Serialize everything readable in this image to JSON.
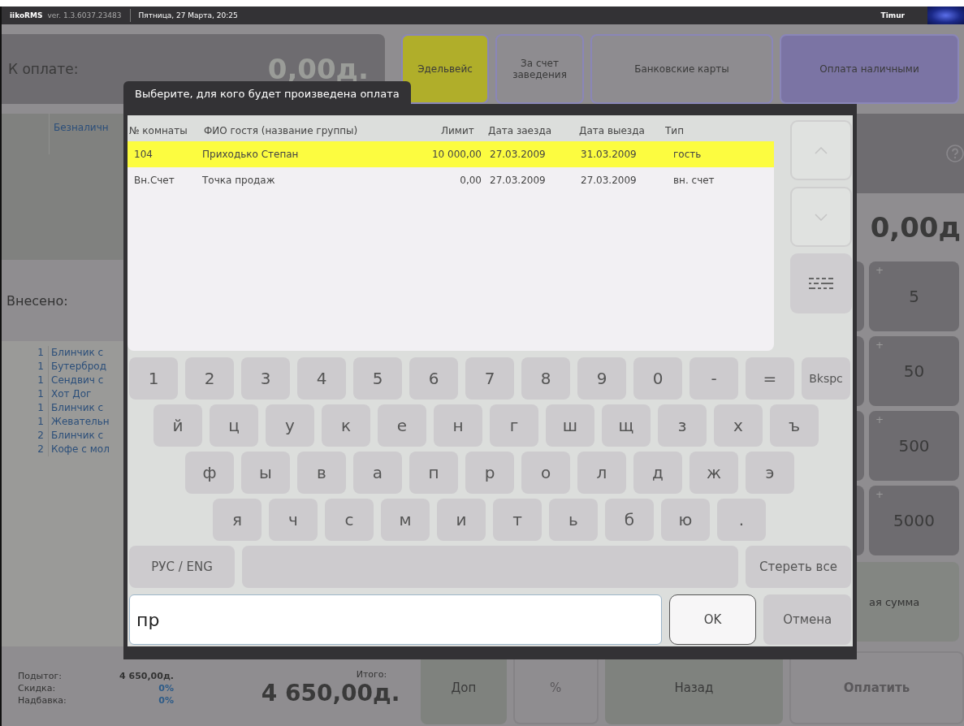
{
  "top_bar": {
    "app": "iikoRMS",
    "version": "ver. 1.3.6037.23483",
    "datetime": "Пятница, 27 Марта, 20:25",
    "user": "Timur"
  },
  "to_pay": {
    "label": "К оплате:",
    "amount": "0,00д."
  },
  "payment_types": [
    {
      "label": "Эдельвейс",
      "color": "#b0ae2a"
    },
    {
      "label": "За счет заведения",
      "color": "#8e8c90"
    },
    {
      "label": "Банковские карты",
      "color": "#8e8c90"
    },
    {
      "label": "Оплата наличными",
      "color": "#7b74a4"
    }
  ],
  "payment_list": {
    "item": "Безналичн"
  },
  "paid": {
    "label": "Внесено:"
  },
  "order_items": [
    {
      "qty": "1",
      "name": "Блинчик с"
    },
    {
      "qty": "1",
      "name": "Бутерброд"
    },
    {
      "qty": "1",
      "name": "Сендвич с"
    },
    {
      "qty": "1",
      "name": "Хот Дог"
    },
    {
      "qty": "1",
      "name": "Блинчик с"
    },
    {
      "qty": "1",
      "name": "Жевательн"
    },
    {
      "qty": "2",
      "name": "Блинчик с"
    },
    {
      "qty": "2",
      "name": "Кофе с мол"
    }
  ],
  "amount_panel": {
    "amount": "0,00д"
  },
  "quick_amounts": [
    {
      "prefix": "+",
      "value": "5"
    },
    {
      "prefix": "+",
      "value": "50"
    },
    {
      "prefix": "+",
      "value": "500"
    },
    {
      "prefix": "+",
      "value": "5000"
    }
  ],
  "sum_button": {
    "label": "ая сумма"
  },
  "totals": {
    "subtotal_label": "Подытог:",
    "subtotal": "4 650,00д.",
    "discount_label": "Скидка:",
    "discount": "0%",
    "markup_label": "Надбавка:",
    "markup": "0%",
    "total_label": "Итого:",
    "total": "4 650,00д."
  },
  "bottom_buttons": [
    {
      "label": "Доп",
      "disabled": false
    },
    {
      "label": "%",
      "disabled": true
    },
    {
      "label": "Назад",
      "disabled": false
    },
    {
      "label": "Оплатить",
      "disabled": true
    }
  ],
  "dialog": {
    "title": "Выберите, для кого будет произведена оплата",
    "columns": [
      "№ комнаты",
      "ФИО гостя (название группы)",
      "Лимит",
      "Дата заезда",
      "Дата выезда",
      "Тип"
    ],
    "rows": [
      {
        "cells": [
          "104",
          "Приходько Степан",
          "10 000,00",
          "27.03.2009",
          "31.03.2009",
          "гость"
        ],
        "selected": true
      },
      {
        "cells": [
          "Вн.Счет",
          "Точка продаж",
          "0,00",
          "27.03.2009",
          "27.03.2009",
          "вн. счет"
        ],
        "selected": false
      }
    ],
    "keyboard": {
      "rows": [
        [
          "1",
          "2",
          "3",
          "4",
          "5",
          "6",
          "7",
          "8",
          "9",
          "0",
          "-",
          "=",
          "Bkspc"
        ],
        [
          "й",
          "ц",
          "у",
          "к",
          "е",
          "н",
          "г",
          "ш",
          "щ",
          "з",
          "х",
          "ъ"
        ],
        [
          "ф",
          "ы",
          "в",
          "а",
          "п",
          "р",
          "о",
          "л",
          "д",
          "ж",
          "э"
        ],
        [
          "я",
          "ч",
          "с",
          "м",
          "и",
          "т",
          "ь",
          "б",
          "ю",
          "."
        ]
      ],
      "lang": "РУС / ENG",
      "clear": "Стереть все"
    },
    "input": {
      "value": "пр"
    },
    "ok": "OK",
    "cancel": "Отмена"
  }
}
